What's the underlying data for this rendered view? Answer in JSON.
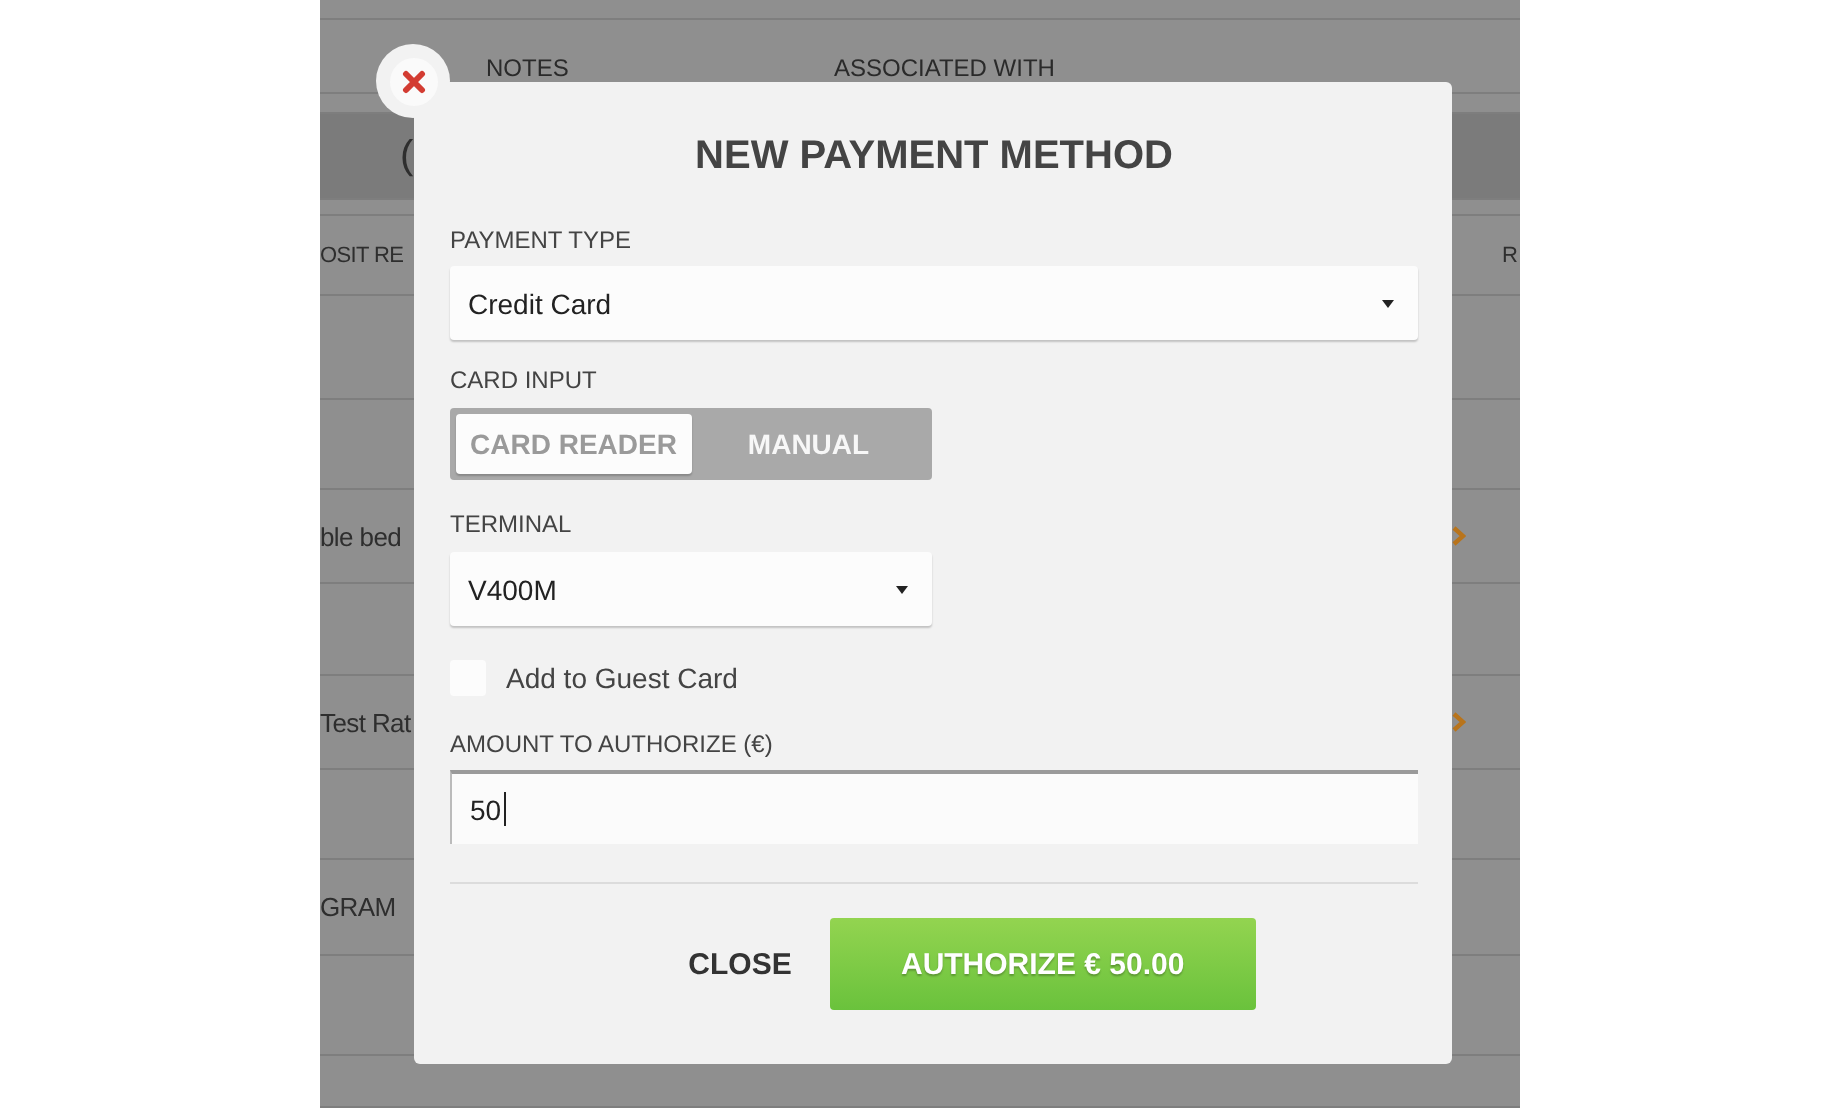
{
  "background": {
    "columns": [
      {
        "label": "NOTES"
      },
      {
        "label": "ASSOCIATED WITH"
      }
    ],
    "rows": [
      {
        "left": "("
      },
      {
        "left": "OSIT RE",
        "right": "R"
      },
      {
        "left": "ble bed",
        "chevron": true
      },
      {
        "left": "Test Rat",
        "chevron": true
      },
      {
        "left": "GRAM"
      }
    ]
  },
  "dialog": {
    "title": "NEW PAYMENT METHOD",
    "payment_type": {
      "label": "PAYMENT TYPE",
      "value": "Credit Card"
    },
    "card_input": {
      "label": "CARD INPUT",
      "options": [
        {
          "label": "CARD READER",
          "selected": true
        },
        {
          "label": "MANUAL",
          "selected": false
        }
      ]
    },
    "terminal": {
      "label": "TERMINAL",
      "value": "V400M"
    },
    "guest_card": {
      "label": "Add to Guest Card",
      "checked": false
    },
    "amount": {
      "label": "AMOUNT TO AUTHORIZE (€)",
      "value": "50"
    },
    "buttons": [
      {
        "kind": "plain",
        "label": "CLOSE"
      },
      {
        "kind": "primary",
        "label": "AUTHORIZE € 50.00"
      }
    ]
  }
}
